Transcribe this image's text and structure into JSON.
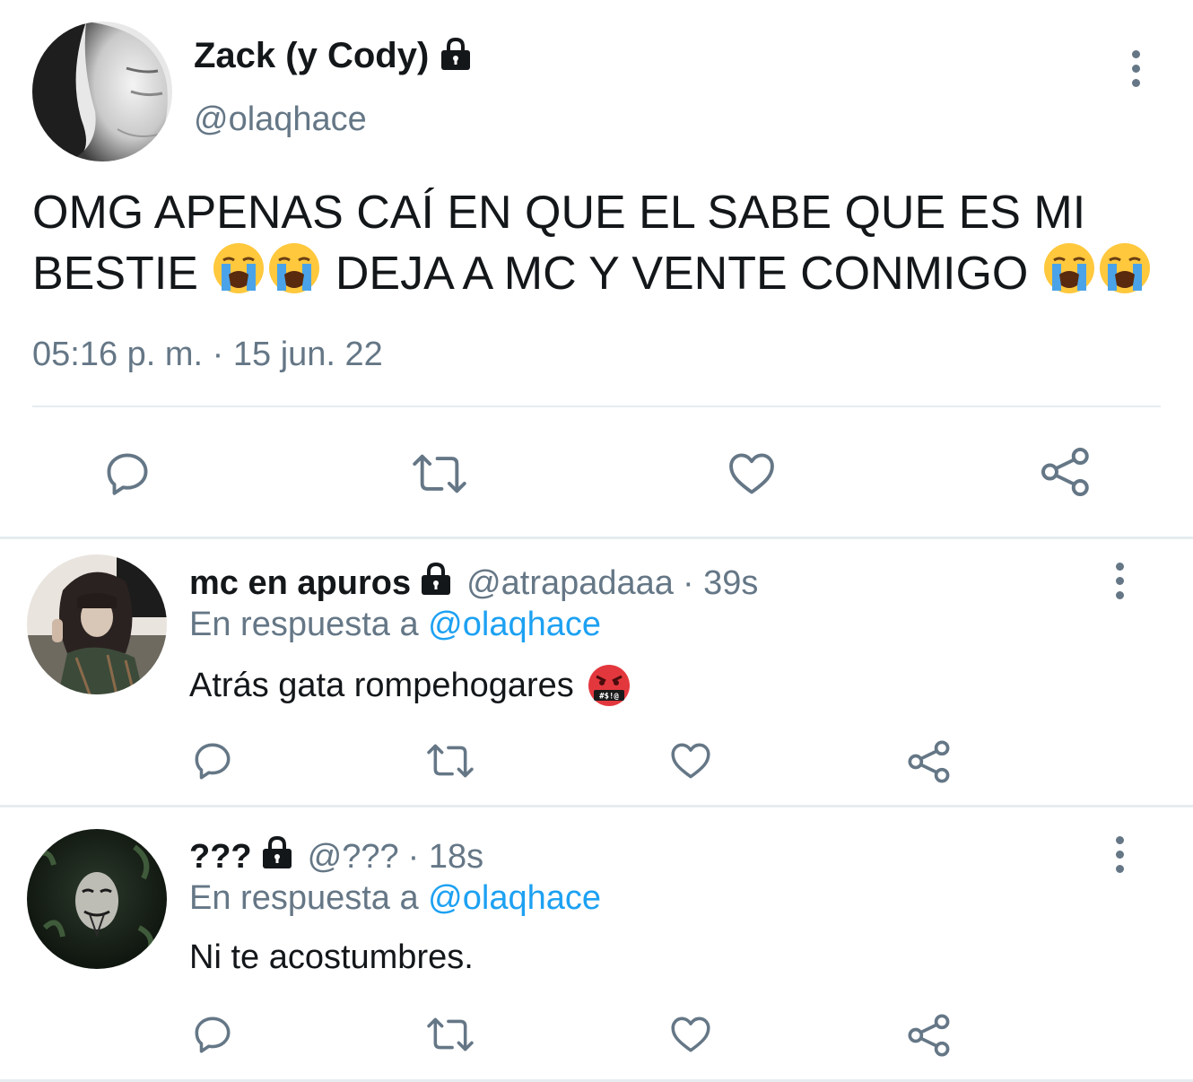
{
  "main_tweet": {
    "name": "Zack (y Cody)",
    "handle": "@olaqhace",
    "text_line1": "OMG APENAS CAÍ EN QUE EL SABE QUE ES MI",
    "text_line2_a": "BESTIE",
    "text_line2_b": "DEJA A MC Y VENTE CONMIGO",
    "timestamp": "05:16 p. m. · 15 jun. 22",
    "emoji": "loudly-crying-face"
  },
  "replies": [
    {
      "name": "mc en apuros",
      "handle": "@atrapadaaa",
      "time": "· 39s",
      "reply_prefix": "En respuesta a",
      "reply_mention": "@olaqhace",
      "text": "Atrás gata rompehogares",
      "emoji": "face-with-symbols-on-mouth"
    },
    {
      "name": "???",
      "handle": "@???",
      "time": "· 18s",
      "reply_prefix": "En respuesta a",
      "reply_mention": "@olaqhace",
      "text": "Ni te acostumbres."
    }
  ],
  "colors": {
    "text": "#14171a",
    "secondary": "#657786",
    "link": "#1da1f2",
    "divider": "#e6ecf0"
  }
}
